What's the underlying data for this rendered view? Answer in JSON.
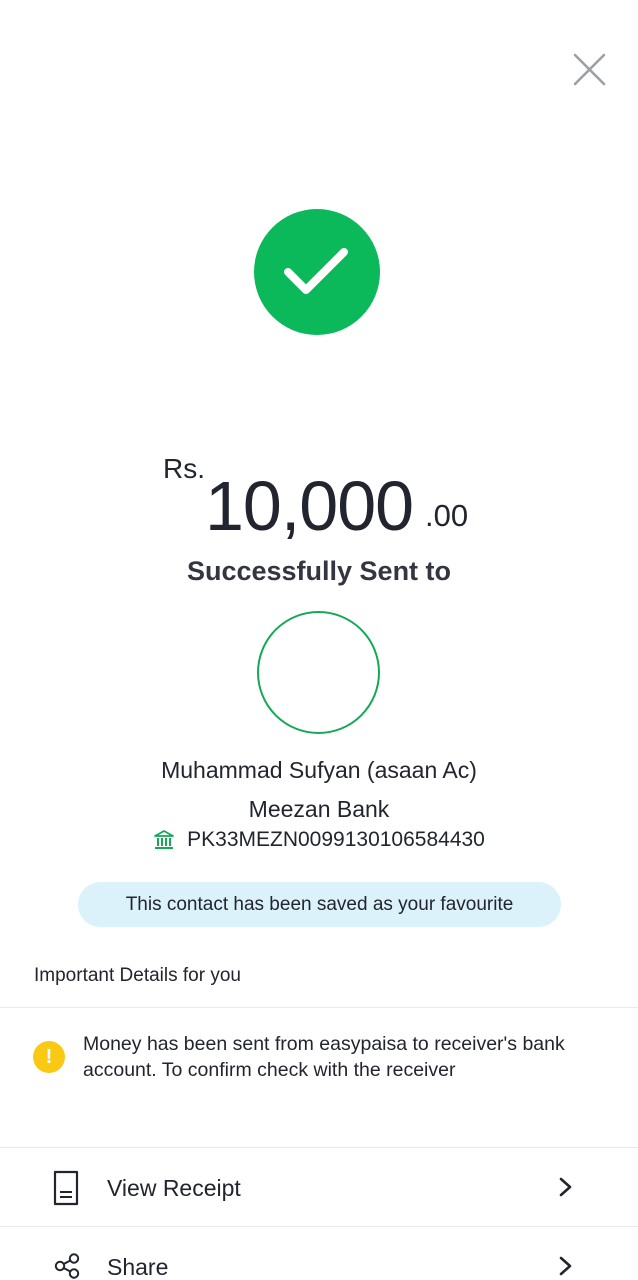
{
  "amount": {
    "currency": "Rs.",
    "whole": "10,000",
    "decimal": ".00"
  },
  "status_text": "Successfully Sent to",
  "recipient": {
    "name": "Muhammad Sufyan (asaan Ac)",
    "bank": "Meezan Bank",
    "iban": "PK33MEZN0099130106584430"
  },
  "favourite_notice": "This contact has been saved as your favourite",
  "details": {
    "title": "Important Details for you",
    "message": "Money has been sent from easypaisa to receiver's bank account. To confirm check with the receiver",
    "icon_glyph": "!"
  },
  "actions": {
    "view_receipt": "View Receipt",
    "share": "Share"
  },
  "colors": {
    "success_green": "#0bb85a",
    "avatar_ring": "#14a857",
    "notice_bg": "#dcf2fb",
    "warning_yellow": "#f9c914"
  },
  "icons": {
    "close": "close-icon",
    "success": "checkmark-icon",
    "bank": "bank-icon",
    "warning": "warning-icon",
    "receipt": "receipt-icon",
    "share": "share-icon",
    "chevron": "chevron-right-icon"
  }
}
